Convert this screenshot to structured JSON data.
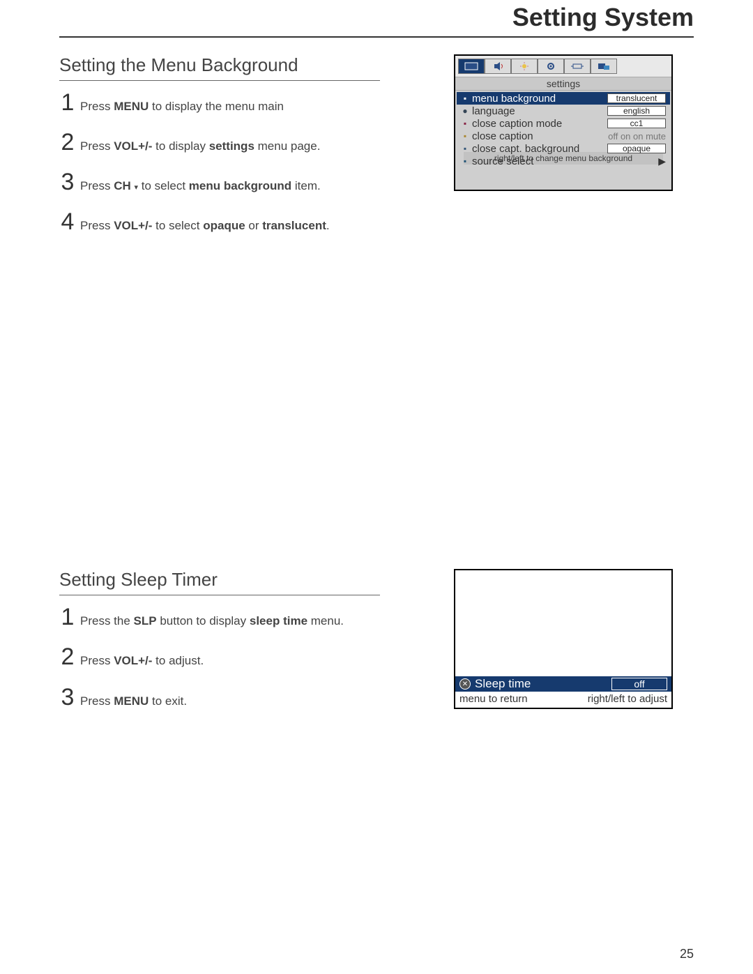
{
  "page_title": "Setting System",
  "page_number": "25",
  "section1": {
    "heading": "Setting the Menu Background",
    "steps": [
      {
        "n": "1",
        "pre": "Press  ",
        "bold1": "MENU",
        "post1": " to display the menu main"
      },
      {
        "n": "2",
        "pre": "Press  ",
        "bold1": "VOL+/-",
        "mid": "  to display  ",
        "bold2": "settings",
        "post2": " menu page."
      },
      {
        "n": "3",
        "pre": "Press  ",
        "bold1": "CH",
        "mid": "  to select ",
        "bold2": "menu background",
        "post2": " item.",
        "arrow_after_bold1": true
      },
      {
        "n": "4",
        "pre": "Press  ",
        "bold1": "VOL+/-",
        "mid": "  to select ",
        "bold2": "opaque",
        "post2": " or ",
        "bold3": "translucent",
        "post3": "."
      }
    ]
  },
  "osd": {
    "title": "settings",
    "items": [
      {
        "label": "menu background",
        "value": "translucent",
        "selected": true
      },
      {
        "label": "language",
        "value": "english"
      },
      {
        "label": "close caption mode",
        "value": "cc1"
      },
      {
        "label": "close caption",
        "trailing": "off    on   on mute"
      },
      {
        "label": "close capt. background",
        "value": "opaque"
      },
      {
        "label": "source select",
        "arrow": "▶"
      }
    ],
    "hint": "right/left to change menu background",
    "tab_names": [
      "picture-icon",
      "speaker-icon",
      "light-icon",
      "settings-icon",
      "width-icon",
      "pip-icon"
    ]
  },
  "section2": {
    "heading": "Setting Sleep Timer",
    "steps": [
      {
        "n": "1",
        "pre": "Press  the  ",
        "bold1": "SLP",
        "mid": "  button to display ",
        "bold2": "sleep time",
        "post2": " menu."
      },
      {
        "n": "2",
        "pre": "Press  ",
        "bold1": "VOL+/-",
        "post1": "  to adjust."
      },
      {
        "n": "3",
        "pre": "Press  ",
        "bold1": "MENU",
        "post1": " to exit."
      }
    ]
  },
  "sleep_panel": {
    "label": "Sleep time",
    "value": "off",
    "hint_left": "menu to return",
    "hint_right": "right/left to adjust"
  }
}
